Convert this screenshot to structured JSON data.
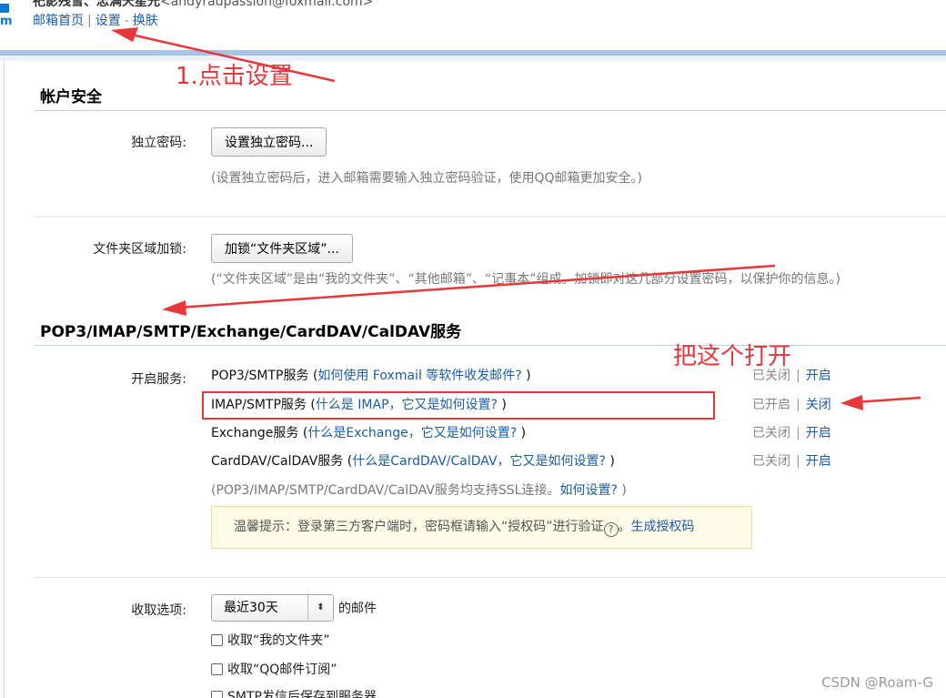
{
  "header": {
    "user_name": "祀影残雪、忠满天星光",
    "user_email": "<andyradpassion@foxmail.com>",
    "links": {
      "home": "邮箱首页",
      "sep1": "|",
      "settings": "设置",
      "sep2": "-",
      "skin": "换肤"
    }
  },
  "account_security": {
    "title": "帐户安全",
    "independent_password": {
      "label": "独立密码:",
      "button": "设置独立密码...",
      "hint": "(设置独立密码后，进入邮箱需要输入独立密码验证，使用QQ邮箱更加安全。)"
    },
    "folder_lock": {
      "label": "文件夹区域加锁:",
      "button": "加锁“文件夹区域”...",
      "hint": "(“文件夹区域”是由“我的文件夹”、“其他邮箱”、“记事本”组成。加锁即对这几部分设置密码，以保护你的信息。)"
    }
  },
  "protocols": {
    "title": "POP3/IMAP/SMTP/Exchange/CardDAV/CalDAV服务",
    "enable_label": "开启服务:",
    "services": [
      {
        "name": "POP3/SMTP服务",
        "open": " (",
        "link": "如何使用 Foxmail 等软件收发邮件?",
        "close": " )",
        "status": "已关闭",
        "sep": "|",
        "action": "开启"
      },
      {
        "name": "IMAP/SMTP服务",
        "open": " (",
        "link": "什么是 IMAP，它又是如何设置?",
        "close": " )",
        "status": "已开启",
        "sep": "|",
        "action": "关闭"
      },
      {
        "name": "Exchange服务",
        "open": " (",
        "link": "什么是Exchange，它又是如何设置?",
        "close": " )",
        "status": "已关闭",
        "sep": "|",
        "action": "开启"
      },
      {
        "name": "CardDAV/CalDAV服务",
        "open": " (",
        "link": "什么是CardDAV/CalDAV，它又是如何设置?",
        "close": " )",
        "status": "已关闭",
        "sep": "|",
        "action": "开启"
      }
    ],
    "ssl_note": {
      "text": "(POP3/IMAP/SMTP/CardDAV/CalDAV服务均支持SSL连接。",
      "link": "如何设置?",
      "close": " )"
    },
    "tip": {
      "text": "温馨提示：登录第三方客户端时，密码框请输入“授权码”进行验证",
      "q": "?",
      "dot": "。",
      "link": "生成授权码"
    }
  },
  "receive": {
    "label": "收取选项:",
    "select_value": "最近30天",
    "select_arrow": "⬍",
    "suffix": "的邮件",
    "options": [
      "收取“我的文件夹”",
      "收取“QQ邮件订阅”",
      "SMTP发信后保存到服务器"
    ]
  },
  "annotations": {
    "step1": "1.点击设置",
    "turn_on": "把这个打开"
  },
  "colors": {
    "annotation": "#e8373a",
    "link": "#1a5da8",
    "accent": "#a7c3e6"
  },
  "watermark": "CSDN @Roam-G"
}
